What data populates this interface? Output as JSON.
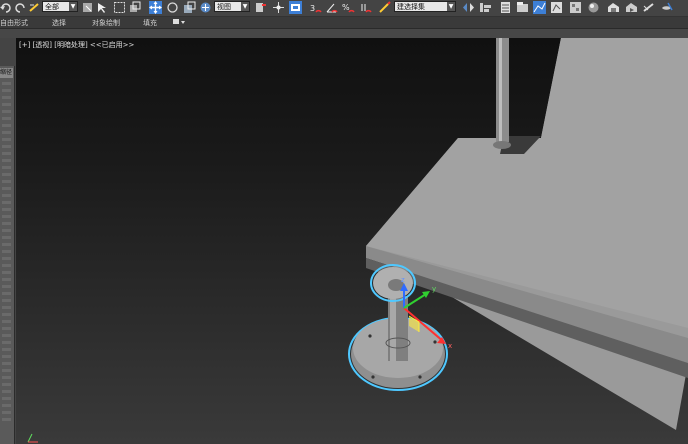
{
  "toolbar": {
    "selection_filter": "全部",
    "ref_coord": "视图",
    "named_selection": "建选择集",
    "icons": [
      "undo-icon",
      "redo-icon",
      "link-icon",
      "unlink-icon",
      "bind-icon",
      "select-filter",
      "select-object-icon",
      "select-by-name-icon",
      "rect-select-icon",
      "window-crossing-icon",
      "move-icon",
      "rotate-icon",
      "scale-icon",
      "ref-coord",
      "pivot-icon",
      "select-manipulate-icon",
      "keyboard-shortcut-icon",
      "snap-3d-icon",
      "angle-snap-icon",
      "percent-snap-icon",
      "spinner-snap-icon",
      "edit-named-selection-icon",
      "named-selection",
      "mirror-icon",
      "align-icon",
      "layer-explorer-icon",
      "toggle-ribbon-icon",
      "curve-editor-icon",
      "schematic-view-icon",
      "material-editor-icon",
      "render-setup-icon",
      "rendered-frame-icon",
      "render-icon",
      "render-cloud-icon",
      "a360-icon"
    ]
  },
  "ribbon": {
    "tabs": [
      "自由形式",
      "选择",
      "对象绘制",
      "填充"
    ],
    "extra_icon": "ribbon-toggle-icon"
  },
  "left_panel": {
    "tag": "缩径"
  },
  "viewport": {
    "label": "[+] [透视] [明暗处理] <<已启用>>",
    "axes": [
      "x",
      "y",
      "z"
    ]
  }
}
